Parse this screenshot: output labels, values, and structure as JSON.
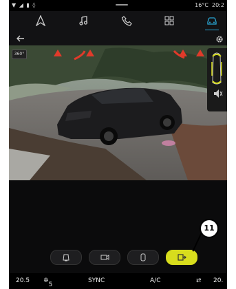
{
  "status": {
    "left_icons": "▼ ◢ ▮ ◊",
    "temp": "16°C",
    "time": "20:2"
  },
  "nav": {
    "items": [
      "navigation-icon",
      "music-icon",
      "phone-icon",
      "apps-icon",
      "car-icon"
    ]
  },
  "camera": {
    "sensor_label": "360°"
  },
  "bottom_buttons": [
    "rear-view",
    "front-view",
    "top-view",
    "auto-park"
  ],
  "climate": {
    "left_temp": "20.5",
    "fan": "5",
    "sync": "SYNC",
    "ac": "A/C",
    "right_temp": "20."
  },
  "callout": {
    "number": "11"
  }
}
